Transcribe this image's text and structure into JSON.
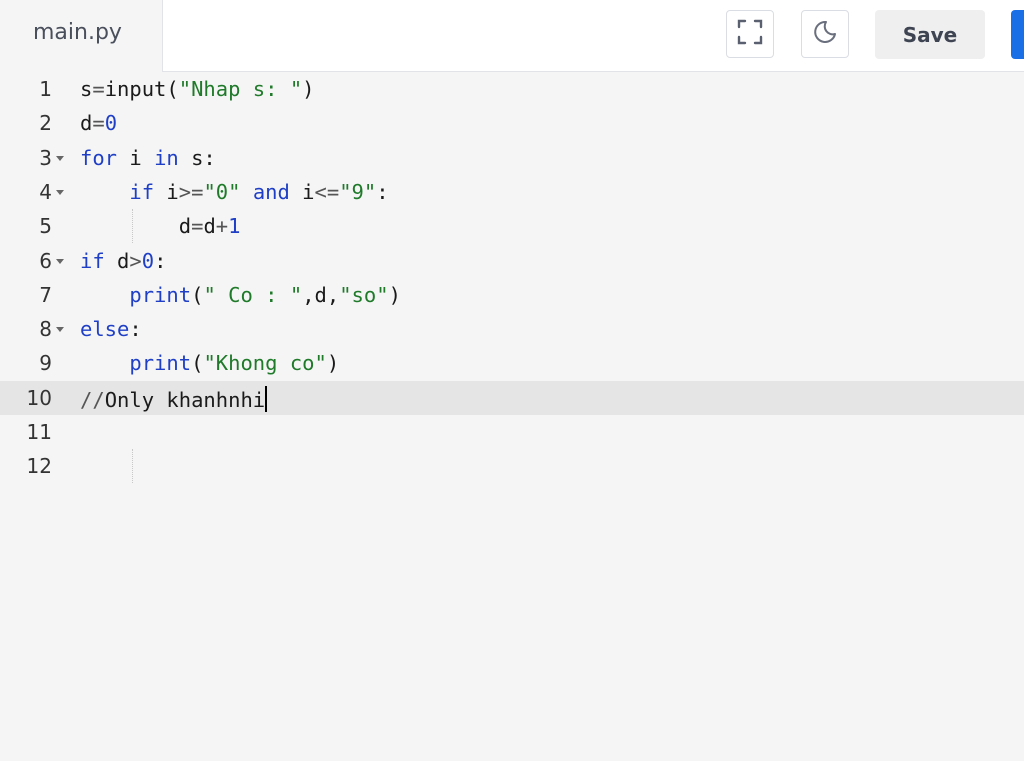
{
  "tab": {
    "label": "main.py"
  },
  "toolbar": {
    "save_label": "Save"
  },
  "colors": {
    "accent": "#1a6fe6",
    "keyword": "#1f3fc6",
    "string": "#1f7a2a"
  },
  "icons": {
    "fullscreen": "fullscreen-icon",
    "theme": "moon-icon"
  },
  "editor": {
    "active_line": 10,
    "lines": [
      {
        "num": "1",
        "foldable": false,
        "tokens": [
          {
            "t": "s",
            "c": ""
          },
          {
            "t": "=",
            "c": "op"
          },
          {
            "t": "input(",
            "c": ""
          },
          {
            "t": "\"Nhap s: \"",
            "c": "str"
          },
          {
            "t": ")",
            "c": ""
          }
        ]
      },
      {
        "num": "2",
        "foldable": false,
        "tokens": [
          {
            "t": "d",
            "c": ""
          },
          {
            "t": "=",
            "c": "op"
          },
          {
            "t": "0",
            "c": "num"
          }
        ]
      },
      {
        "num": "3",
        "foldable": true,
        "tokens": [
          {
            "t": "for",
            "c": "kw"
          },
          {
            "t": " i ",
            "c": ""
          },
          {
            "t": "in",
            "c": "kw"
          },
          {
            "t": " s:",
            "c": ""
          }
        ]
      },
      {
        "num": "4",
        "foldable": true,
        "tokens": [
          {
            "t": "    ",
            "c": ""
          },
          {
            "t": "if",
            "c": "kw"
          },
          {
            "t": " i",
            "c": ""
          },
          {
            "t": ">=",
            "c": "op"
          },
          {
            "t": "\"0\"",
            "c": "str"
          },
          {
            "t": " ",
            "c": ""
          },
          {
            "t": "and",
            "c": "kw"
          },
          {
            "t": " i",
            "c": ""
          },
          {
            "t": "<=",
            "c": "op"
          },
          {
            "t": "\"9\"",
            "c": "str"
          },
          {
            "t": ":",
            "c": ""
          }
        ]
      },
      {
        "num": "5",
        "foldable": false,
        "tokens": [
          {
            "t": "        d",
            "c": ""
          },
          {
            "t": "=",
            "c": "op"
          },
          {
            "t": "d",
            "c": ""
          },
          {
            "t": "+",
            "c": "op"
          },
          {
            "t": "1",
            "c": "num"
          }
        ]
      },
      {
        "num": "6",
        "foldable": true,
        "tokens": [
          {
            "t": "if",
            "c": "kw"
          },
          {
            "t": " d",
            "c": ""
          },
          {
            "t": ">",
            "c": "op"
          },
          {
            "t": "0",
            "c": "num"
          },
          {
            "t": ":",
            "c": ""
          }
        ]
      },
      {
        "num": "7",
        "foldable": false,
        "tokens": [
          {
            "t": "    ",
            "c": ""
          },
          {
            "t": "print",
            "c": "kw"
          },
          {
            "t": "(",
            "c": ""
          },
          {
            "t": "\" Co : \"",
            "c": "str"
          },
          {
            "t": ",d,",
            "c": ""
          },
          {
            "t": "\"so\"",
            "c": "str"
          },
          {
            "t": ")",
            "c": ""
          }
        ]
      },
      {
        "num": "8",
        "foldable": true,
        "tokens": [
          {
            "t": "else",
            "c": "kw"
          },
          {
            "t": ":",
            "c": ""
          }
        ]
      },
      {
        "num": "9",
        "foldable": false,
        "tokens": [
          {
            "t": "    ",
            "c": ""
          },
          {
            "t": "print",
            "c": "kw"
          },
          {
            "t": "(",
            "c": ""
          },
          {
            "t": "\"Khong co\"",
            "c": "str"
          },
          {
            "t": ")",
            "c": ""
          }
        ]
      },
      {
        "num": "10",
        "foldable": false,
        "tokens": [
          {
            "t": "//",
            "c": "op"
          },
          {
            "t": "Only khanhnhi",
            "c": ""
          }
        ]
      },
      {
        "num": "11",
        "foldable": false,
        "tokens": []
      },
      {
        "num": "12",
        "foldable": false,
        "tokens": []
      }
    ]
  }
}
